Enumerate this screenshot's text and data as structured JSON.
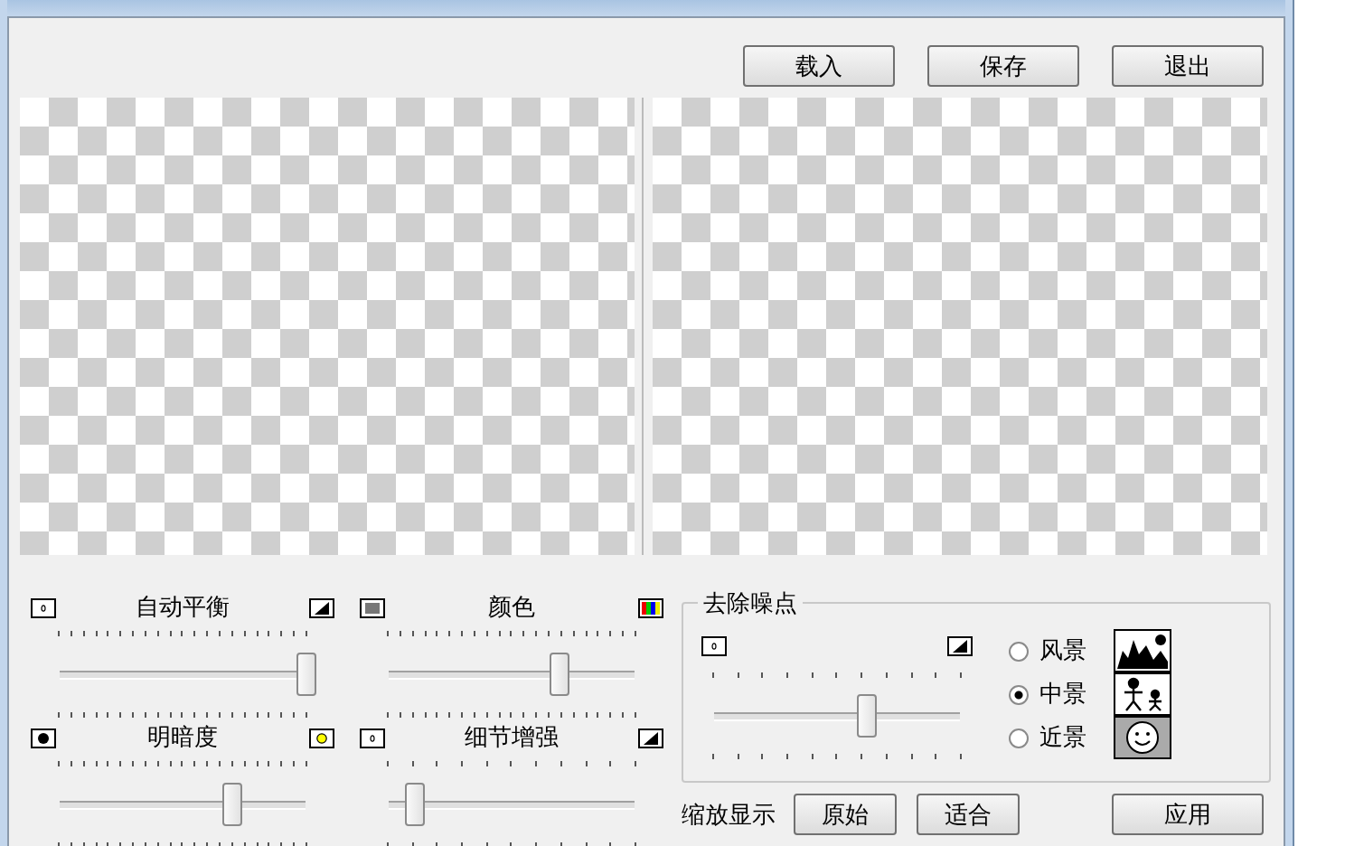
{
  "toolbar": {
    "buttons": [
      "载入",
      "保存",
      "退出"
    ]
  },
  "sliders": [
    {
      "label": "自动平衡",
      "level": 1.0
    },
    {
      "label": "颜色",
      "level": 0.69
    },
    {
      "label": "明暗度",
      "level": 0.7
    },
    {
      "label": "细节增强",
      "level": 0.1
    }
  ],
  "noise": {
    "title": "去除噪点",
    "level": 0.62,
    "options": [
      {
        "label": "风景",
        "selected": false
      },
      {
        "label": "中景",
        "selected": true
      },
      {
        "label": "近景",
        "selected": false
      }
    ]
  },
  "zoom": {
    "label": "缩放显示",
    "buttons": [
      "原始",
      "适合"
    ]
  },
  "apply_button": "应用"
}
